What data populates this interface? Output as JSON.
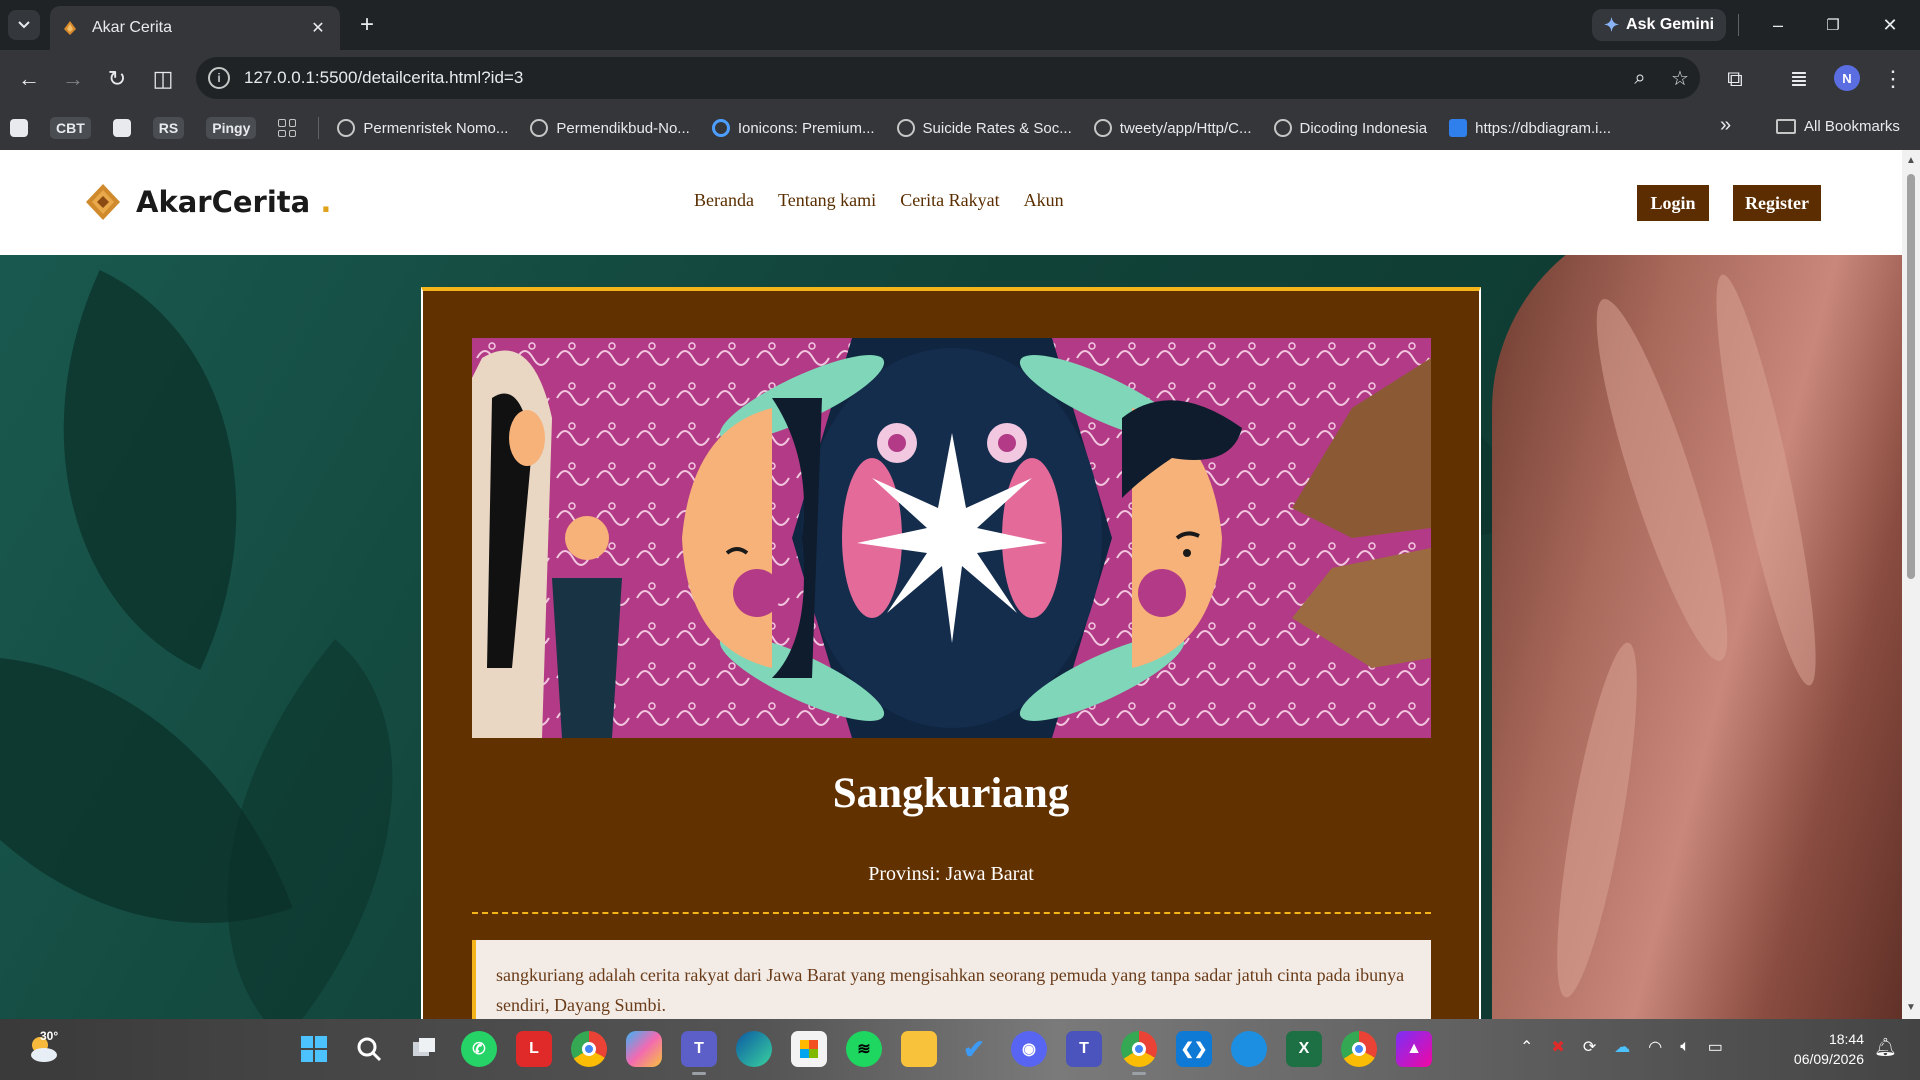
{
  "browser": {
    "tab_title": "Akar Cerita",
    "tab_close": "✕",
    "new_tab": "+",
    "gemini_label": "Ask Gemini",
    "url": "127.0.0.1:5500/detailcerita.html?id=3",
    "profile_initial": "N",
    "window_controls": {
      "minimize": "–",
      "restore": "❐",
      "close": "✕"
    },
    "nav": {
      "back": "←",
      "forward": "→",
      "reload": "↻",
      "split": "◫"
    },
    "omni_icons": {
      "zoom": "⌕",
      "star": "☆",
      "extensions": "⧉",
      "media": "≣",
      "menu": "⋮"
    },
    "bookmarks": [
      {
        "label": "CBT",
        "kind": "chip"
      },
      {
        "label": "RS",
        "kind": "chip"
      },
      {
        "label": "Pingy",
        "kind": "chip"
      },
      {
        "label": "Permenristek Nomo...",
        "kind": "globe"
      },
      {
        "label": "Permendikbud-No...",
        "kind": "globe"
      },
      {
        "label": "Ionicons: Premium...",
        "kind": "ion"
      },
      {
        "label": "Suicide Rates & Soc...",
        "kind": "globe"
      },
      {
        "label": "tweety/app/Http/C...",
        "kind": "globe"
      },
      {
        "label": "Dicoding Indonesia",
        "kind": "globe"
      },
      {
        "label": "https://dbdiagram.i...",
        "kind": "db"
      }
    ],
    "bookmarks_more": "»",
    "all_bookmarks": "All Bookmarks"
  },
  "site": {
    "logo_text": "AkarCerita",
    "logo_dot": ".",
    "nav": [
      "Beranda",
      "Tentang kami",
      "Cerita Rakyat",
      "Akun"
    ],
    "login_label": "Login",
    "register_label": "Register"
  },
  "story": {
    "title": "Sangkuriang",
    "province": "Provinsi: Jawa Barat",
    "synopsis": "sangkuriang adalah cerita rakyat dari Jawa Barat yang mengisahkan seorang pemuda yang tanpa sadar jatuh cinta pada ibunya sendiri, Dayang Sumbi."
  },
  "taskbar": {
    "temperature": "30°",
    "time": "18:44",
    "date": "06/09/2026",
    "apps": [
      {
        "name": "windows-start",
        "label": ""
      },
      {
        "name": "search",
        "label": ""
      },
      {
        "name": "task-view",
        "label": ""
      },
      {
        "name": "whatsapp",
        "label": ""
      },
      {
        "name": "l-app",
        "label": "L"
      },
      {
        "name": "chrome",
        "label": ""
      },
      {
        "name": "copilot",
        "label": ""
      },
      {
        "name": "teams",
        "label": ""
      },
      {
        "name": "edge",
        "label": ""
      },
      {
        "name": "store",
        "label": ""
      },
      {
        "name": "spotify",
        "label": ""
      },
      {
        "name": "explorer",
        "label": ""
      },
      {
        "name": "todo",
        "label": ""
      },
      {
        "name": "discord",
        "label": ""
      },
      {
        "name": "teams-classic",
        "label": ""
      },
      {
        "name": "chrome-profile",
        "label": ""
      },
      {
        "name": "vscode",
        "label": ""
      },
      {
        "name": "app-blue",
        "label": ""
      },
      {
        "name": "excel",
        "label": ""
      },
      {
        "name": "chrome-2",
        "label": ""
      },
      {
        "name": "affinity",
        "label": ""
      }
    ]
  },
  "colors": {
    "brown": "#623100",
    "gold": "#f4b41a",
    "header_bg": "#ffffff",
    "nav_text": "#5a2e00"
  }
}
